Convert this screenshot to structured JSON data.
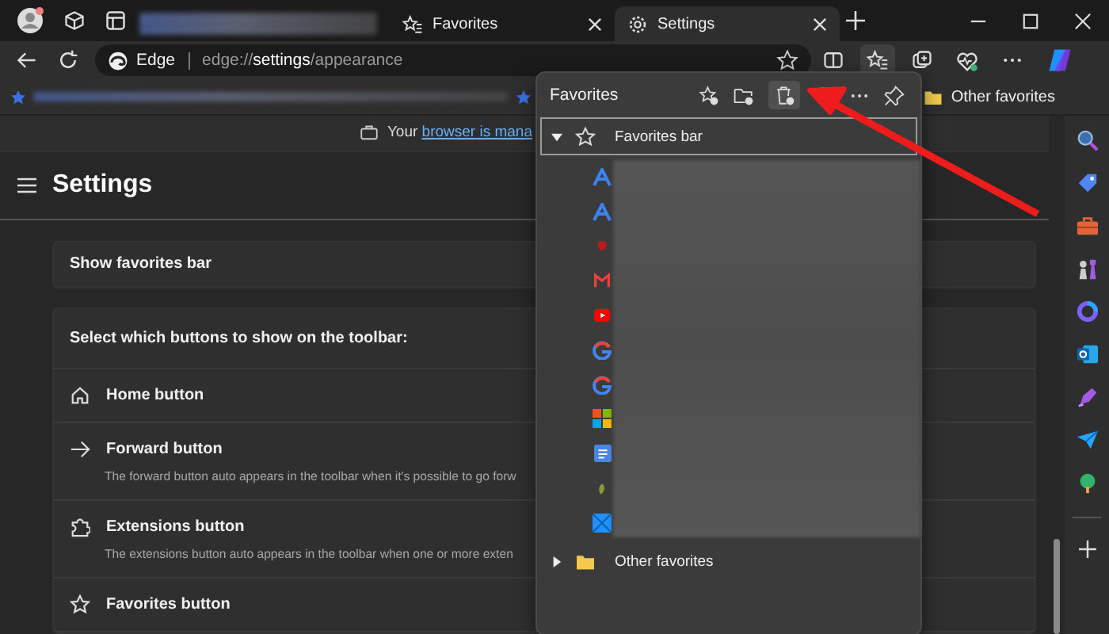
{
  "tabs": [
    {
      "kind": "blurred",
      "selected": false
    },
    {
      "kind": "page",
      "label": "Favorites",
      "selected": false
    },
    {
      "kind": "page",
      "label": "Settings",
      "selected": true
    }
  ],
  "address_bar": {
    "site_label": "Edge",
    "url_scheme": "edge://",
    "url_page": "settings",
    "url_path": "/appearance"
  },
  "favorites_bar": {
    "folder": "Other favorites"
  },
  "notice": {
    "text": "Your",
    "link": "browser is mana"
  },
  "settings": {
    "title": "Settings",
    "show_favorites_bar": "Show favorites bar",
    "toolbar_heading": "Select which buttons to show on the toolbar:",
    "rows": [
      {
        "kind": "home",
        "label": "Home button"
      },
      {
        "kind": "forward",
        "label": "Forward button",
        "description": "The forward button auto appears in the toolbar when it's possible to go forw"
      },
      {
        "kind": "extensions",
        "label": "Extensions button",
        "description": "The extensions button auto appears in the toolbar when one or more exten"
      },
      {
        "kind": "favorites",
        "label": "Favorites button"
      }
    ]
  },
  "favorites_panel": {
    "title": "Favorites",
    "tree": [
      {
        "label": "Favorites bar",
        "expanded": true,
        "selected": true,
        "children": [
          {
            "kind": "a"
          },
          {
            "kind": "a"
          },
          {
            "kind": "shield"
          },
          {
            "kind": "m"
          },
          {
            "kind": "play"
          },
          {
            "kind": "g"
          },
          {
            "kind": "g"
          },
          {
            "kind": "grid"
          },
          {
            "kind": "doc"
          },
          {
            "kind": "leaf"
          },
          {
            "kind": "tile"
          }
        ]
      },
      {
        "label": "Other favorites",
        "expanded": false,
        "selected": false
      }
    ]
  }
}
